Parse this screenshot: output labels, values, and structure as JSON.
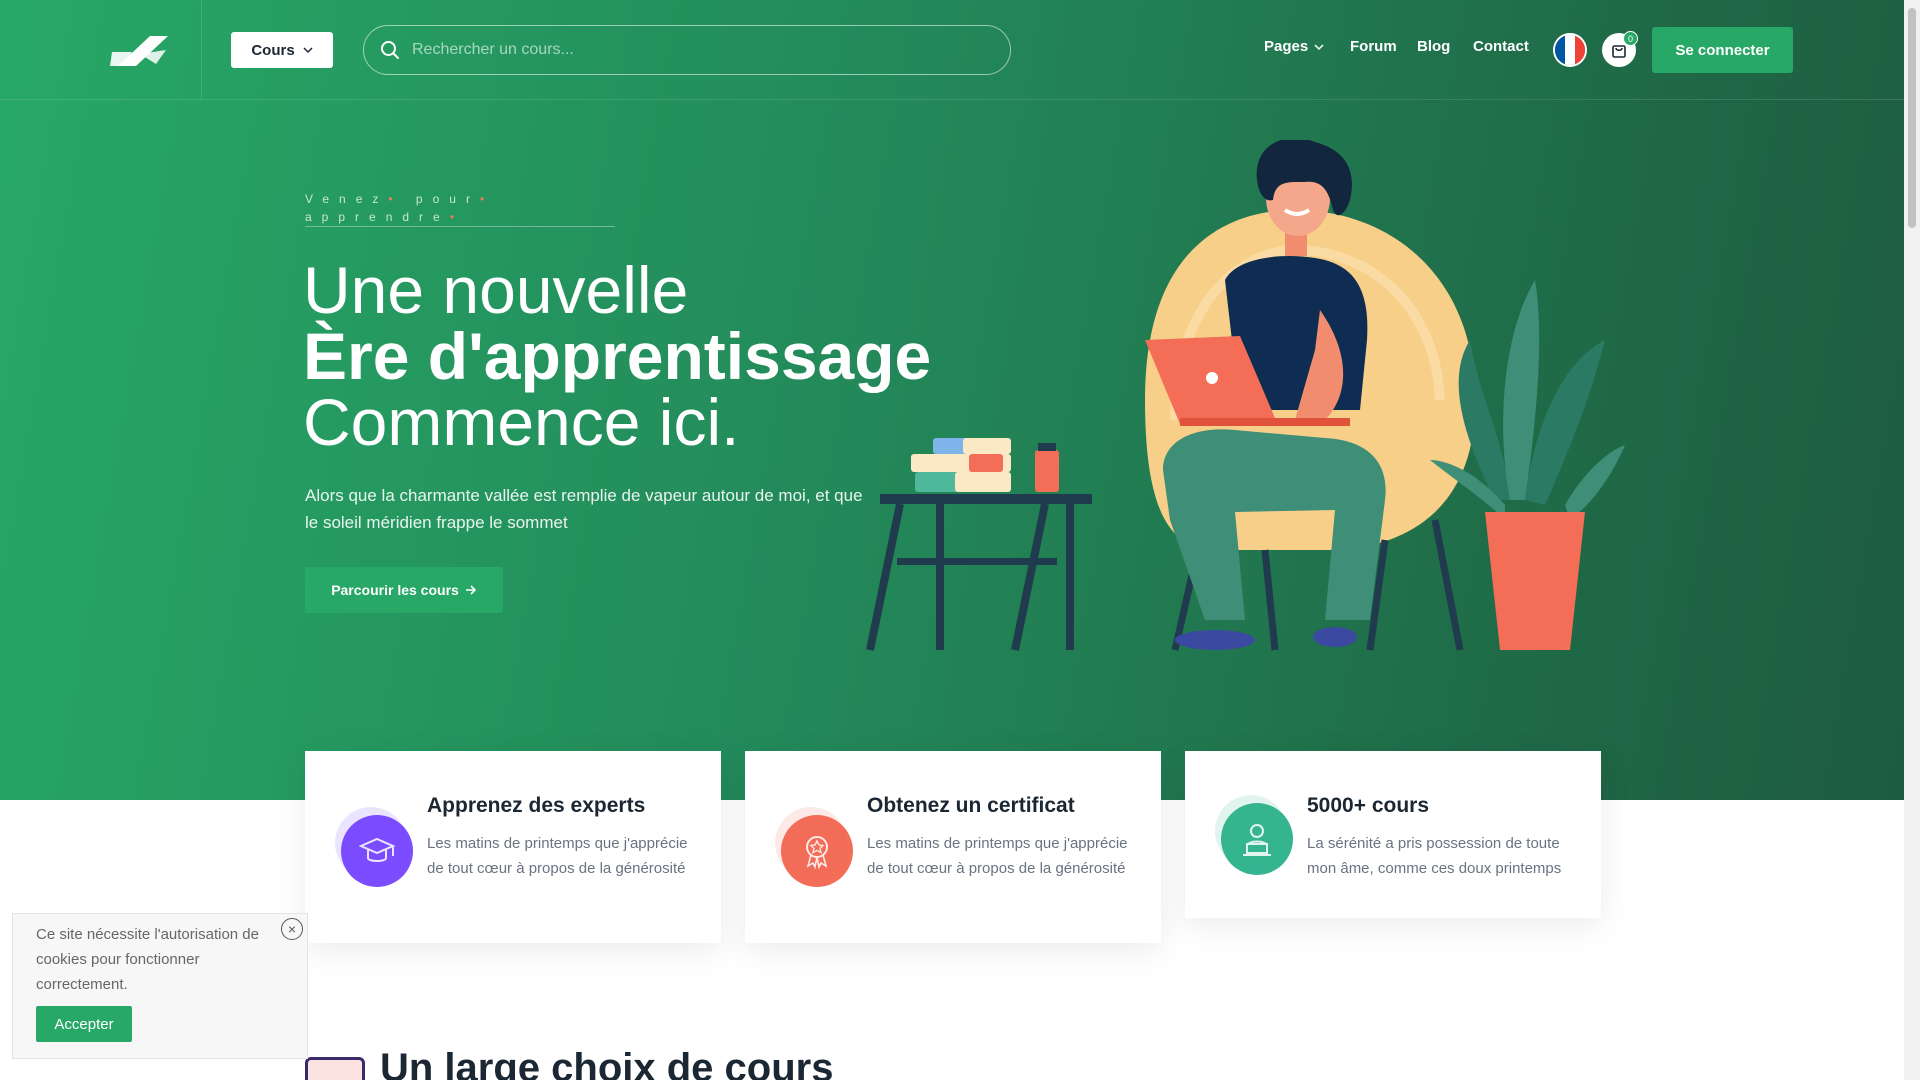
{
  "header": {
    "cours_label": "Cours",
    "search_placeholder": "Rechercher un cours...",
    "nav": [
      {
        "label": "Pages"
      },
      {
        "label": "Forum"
      },
      {
        "label": "Blog"
      },
      {
        "label": "Contact"
      }
    ],
    "cart_count": "0",
    "login_label": "Se connecter"
  },
  "hero": {
    "eyebrow_words": [
      "Venez",
      "pour",
      "apprendre"
    ],
    "title_line1": "Une nouvelle",
    "title_line2": "Ère d'apprentissage",
    "title_line3": "Commence ici.",
    "description": "Alors que la charmante vallée est remplie de vapeur autour de moi, et que le soleil méridien frappe le sommet",
    "button_label": "Parcourir les cours",
    "button_icon": "arrow-right-icon"
  },
  "features": [
    {
      "title": "Apprenez des experts",
      "text": "Les matins de printemps que j'apprécie de tout cœur à propos de la générosité",
      "icon": "graduation-cap-icon",
      "color": "#7c4dff"
    },
    {
      "title": "Obtenez un certificat",
      "text": "Les matins de printemps que j'apprécie de tout cœur à propos de la générosité",
      "icon": "certificate-icon",
      "color": "#f46d57"
    },
    {
      "title": "5000+ cours",
      "text": "La sérénité a pris possession de toute mon âme, comme ces doux printemps",
      "icon": "laptop-user-icon",
      "color": "#35b58f"
    }
  ],
  "section": {
    "title": "Un large choix de cours"
  },
  "cookie": {
    "text": "Ce site nécessite l'autorisation de cookies pour fonctionner correctement.",
    "accept_label": "Accepter"
  },
  "colors": {
    "brand": "#27a866",
    "accent": "#f07a5c",
    "flag": [
      "#0055a4",
      "#ffffff",
      "#ef4135"
    ]
  }
}
